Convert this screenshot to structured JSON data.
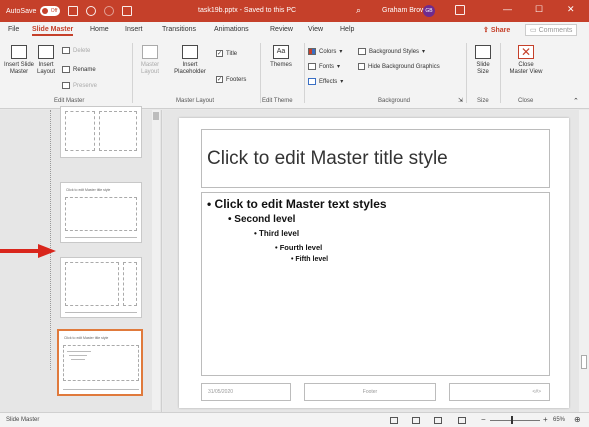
{
  "titlebar": {
    "autosave_label": "AutoSave",
    "autosave_state": "Off",
    "filename": "task19b.pptx - Saved to this PC",
    "search_glyph": "⌕",
    "user_name": "Graham Brown",
    "user_initials": "GB",
    "minimize": "—",
    "maximize": "☐",
    "close": "✕"
  },
  "tabs": [
    {
      "label": "File"
    },
    {
      "label": "Slide Master"
    },
    {
      "label": "Home"
    },
    {
      "label": "Insert"
    },
    {
      "label": "Transitions"
    },
    {
      "label": "Animations"
    },
    {
      "label": "Review"
    },
    {
      "label": "View"
    },
    {
      "label": "Help"
    }
  ],
  "share_label": "Share",
  "comments_label": "Comments",
  "ribbon": {
    "insert_slide_master": "Insert Slide\nMaster",
    "insert_layout": "Insert\nLayout",
    "delete": "Delete",
    "rename": "Rename",
    "preserve": "Preserve",
    "master_layout": "Master\nLayout",
    "insert_placeholder": "Insert\nPlaceholder",
    "title_check": "Title",
    "footers_check": "Footers",
    "themes": "Themes",
    "colors": "Colors",
    "fonts": "Fonts",
    "effects": "Effects",
    "background_styles": "Background Styles",
    "hide_background_graphics": "Hide Background Graphics",
    "slide_size": "Slide\nSize",
    "close_master_view": "Close\nMaster View",
    "groups": {
      "edit_master": "Edit Master",
      "master_layout": "Master Layout",
      "edit_theme": "Edit Theme",
      "background": "Background",
      "size": "Size",
      "close": "Close"
    }
  },
  "thumbnails": {
    "title_text": "Click to edit Master title style"
  },
  "slide": {
    "title": "Click to edit Master title style",
    "levels": [
      "Click to edit Master text styles",
      "Second level",
      "Third level",
      "Fourth level",
      "Fifth level"
    ],
    "date": "31/05/2020",
    "footer": "Footer",
    "page_number": "<#>"
  },
  "statusbar": {
    "label": "Slide Master",
    "zoom": "65%"
  },
  "colors": {
    "accent": "#c5402a",
    "selection": "#e07a3c",
    "arrow": "#d9261c"
  }
}
